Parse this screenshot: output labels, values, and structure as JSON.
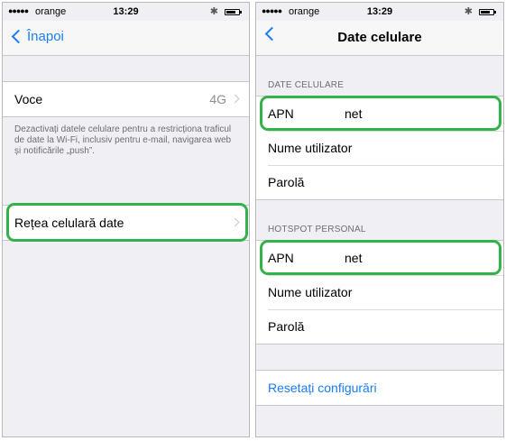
{
  "left_screen": {
    "status": {
      "dots": "●●●●●",
      "carrier": "orange",
      "time": "13:29",
      "bluetooth": "✱"
    },
    "back_label": "Înapoi",
    "voce": {
      "label": "Voce",
      "value": "4G"
    },
    "note": "Dezactivați datele celulare pentru a restricționa traficul de date la Wi-Fi, inclusiv pentru e-mail, navigarea web și notificările „push”.",
    "retea": {
      "label": "Rețea celulară date"
    }
  },
  "right_screen": {
    "status": {
      "dots": "●●●●●",
      "carrier": "orange",
      "time": "13:29",
      "bluetooth": "✱"
    },
    "title": "Date celulare",
    "date_celulare": {
      "header": "DATE CELULARE",
      "rows": [
        {
          "label": "APN",
          "value": "net"
        },
        {
          "label": "Nume utilizator",
          "value": ""
        },
        {
          "label": "Parolă",
          "value": ""
        }
      ]
    },
    "hotspot": {
      "header": "HOTSPOT PERSONAL",
      "rows": [
        {
          "label": "APN",
          "value": "net"
        },
        {
          "label": "Nume utilizator",
          "value": ""
        },
        {
          "label": "Parolă",
          "value": ""
        }
      ]
    },
    "reset_label": "Resetați configurări"
  },
  "colors": {
    "accent": "#1a7cf6",
    "highlight": "#32b24a",
    "background": "#efeff4"
  }
}
